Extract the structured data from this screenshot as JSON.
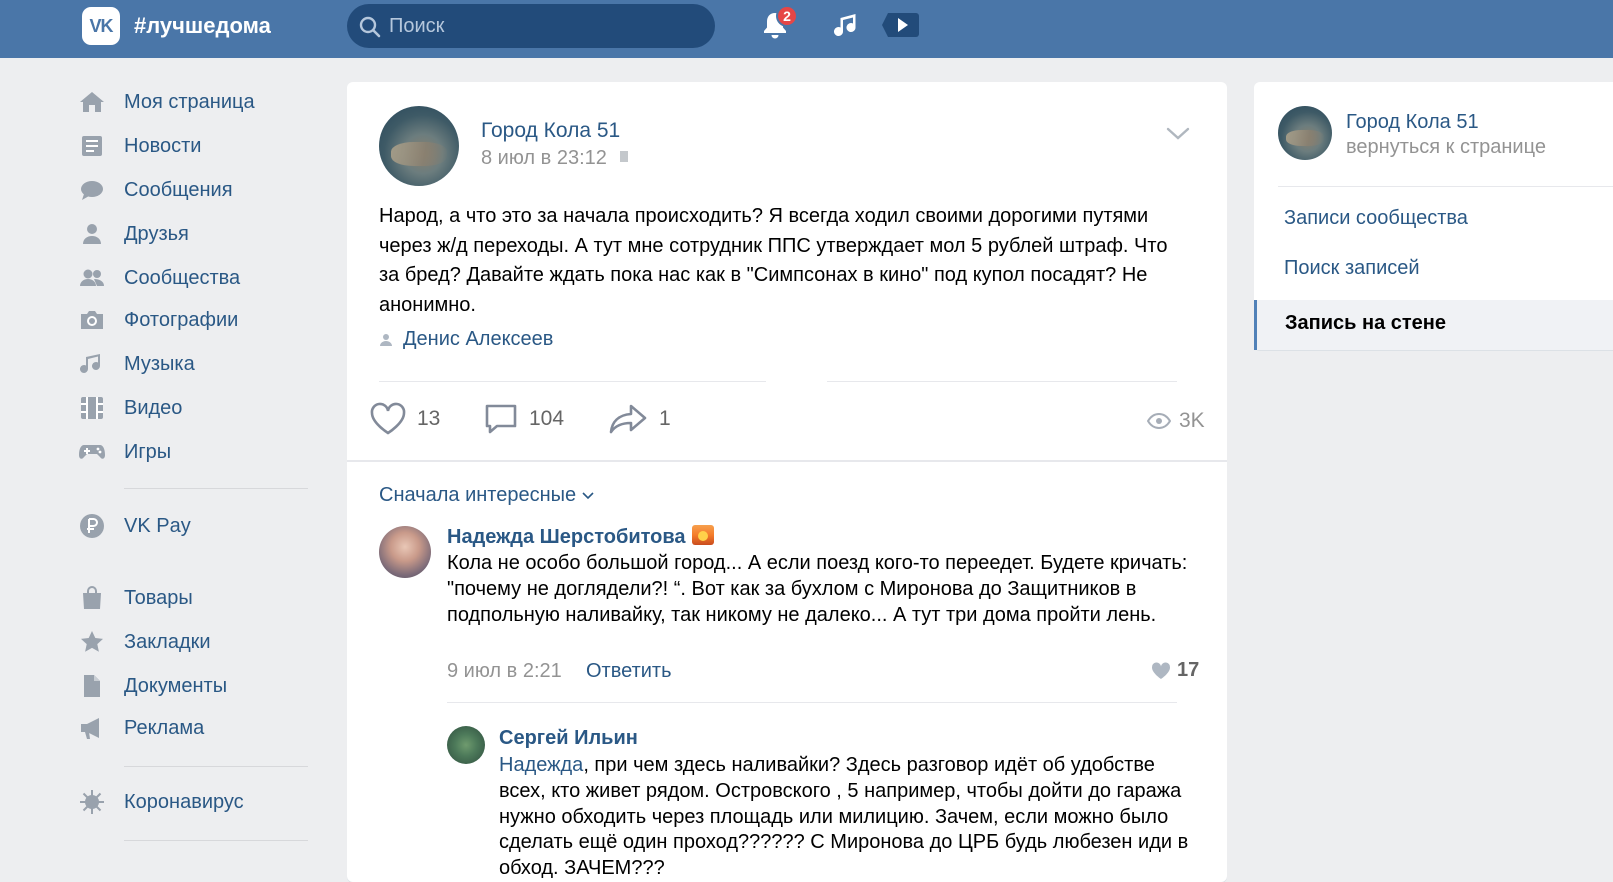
{
  "header": {
    "logo": "VK",
    "title": "#лучшедома",
    "search_placeholder": "Поиск",
    "notifications_count": "2"
  },
  "nav": {
    "items": [
      {
        "label": "Моя страница",
        "icon": "home-icon"
      },
      {
        "label": "Новости",
        "icon": "news-icon"
      },
      {
        "label": "Сообщения",
        "icon": "chat-icon"
      },
      {
        "label": "Друзья",
        "icon": "user-icon"
      },
      {
        "label": "Сообщества",
        "icon": "group-icon"
      },
      {
        "label": "Фотографии",
        "icon": "camera-icon"
      },
      {
        "label": "Музыка",
        "icon": "music-icon"
      },
      {
        "label": "Видео",
        "icon": "film-icon"
      },
      {
        "label": "Игры",
        "icon": "gamepad-icon"
      },
      {
        "label": "VK Pay",
        "icon": "ruble-icon"
      },
      {
        "label": "Товары",
        "icon": "bag-icon"
      },
      {
        "label": "Закладки",
        "icon": "star-icon"
      },
      {
        "label": "Документы",
        "icon": "document-icon"
      },
      {
        "label": "Реклама",
        "icon": "megaphone-icon"
      },
      {
        "label": "Коронавирус",
        "icon": "virus-icon"
      }
    ]
  },
  "post": {
    "author": "Город Кола 51",
    "date": "8 июл в 23:12",
    "text": "Народ, а что это за           начала происходить? Я всегда ходил своими дорогими путями через ж/д переходы. А тут мне сотрудник ППС утверждает мол 5 рублей штраф. Что за бред? Давайте ждать пока нас как в \"Симпсонах в кино\" под купол посадят? Не анонимно.",
    "signer": "Денис Алексеев",
    "likes": "13",
    "comments": "104",
    "shares": "1",
    "views": "3K"
  },
  "comments": {
    "sort_label": "Сначала интересные",
    "items": [
      {
        "author": "Надежда Шерстобитова",
        "text": "Кола не особо большой город... А если поезд кого-то переедет. Будете кричать: \"почему не доглядели?! “. Вот как за бухлом с Миронова до Защитников в подпольную наливайку, так никому не далеко... А тут три дома пройти лень.",
        "date": "9 июл в 2:21",
        "reply_label": "Ответить",
        "likes": "17"
      },
      {
        "author": "Сергей Ильин",
        "mention": "Надежда",
        "text": ", при чем здесь наливайки? Здесь разговор идёт об удобстве всех, кто живет рядом. Островского , 5 например, чтобы дойти до гаража нужно обходить через площадь или милицию. Зачем, если можно было сделать ещё один проход?????? С Миронова до ЦРБ будь любезен иди в обход. ЗАЧЕМ???"
      }
    ]
  },
  "sidebar_right": {
    "group_name": "Город Кола 51",
    "back_label": "вернуться к странице",
    "items": [
      "Записи сообщества",
      "Поиск записей"
    ],
    "active_item": "Запись на стене"
  },
  "colors": {
    "header_bg": "#4a76a8",
    "link": "#2a5885",
    "page_bg": "#edeef0",
    "badge": "#e64646"
  }
}
